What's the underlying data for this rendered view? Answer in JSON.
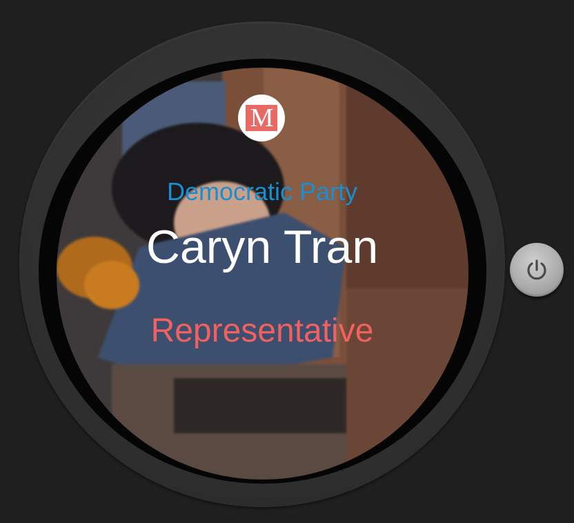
{
  "card": {
    "logo_letter": "M",
    "party": "Democratic Party",
    "name": "Caryn Tran",
    "role": "Representative"
  },
  "icons": {
    "logo": "m-logo-icon",
    "power": "power-icon"
  },
  "colors": {
    "background": "#1f1f1f",
    "party_text": "#1a8ed0",
    "name_text": "#ffffff",
    "role_text": "#f0615f",
    "logo_accent": "#e86a64"
  }
}
